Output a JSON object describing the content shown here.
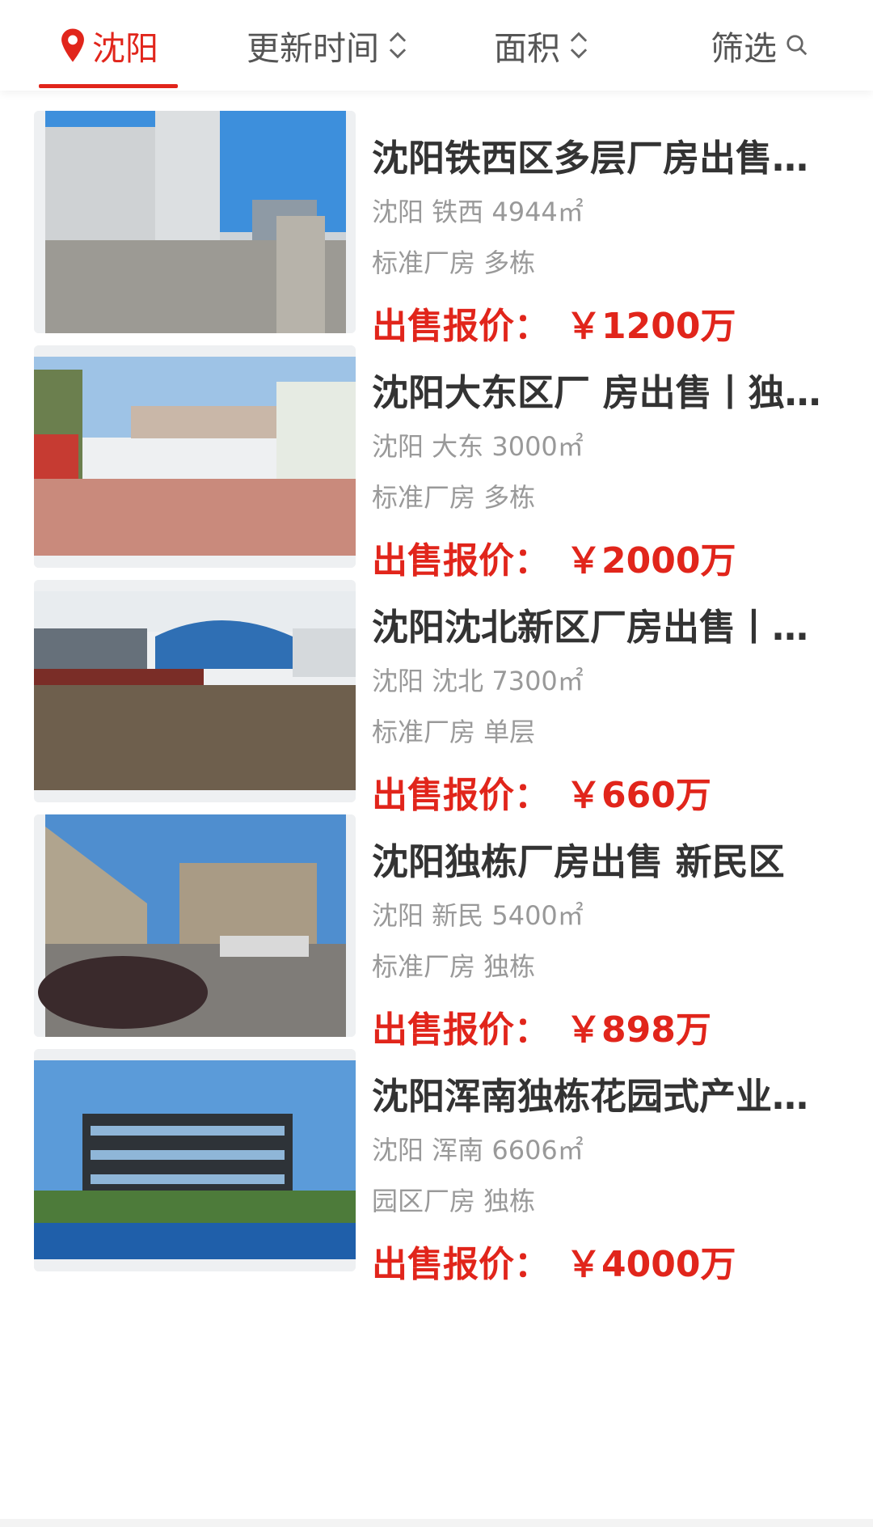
{
  "colors": {
    "accent": "#e1251b",
    "text_main": "#333333",
    "text_muted": "#999999"
  },
  "filter_bar": {
    "city": {
      "label": "沈阳",
      "icon": "location-pin-icon"
    },
    "update_time": {
      "label": "更新时间",
      "icon": "sort-updown-icon"
    },
    "area": {
      "label": "面积",
      "icon": "sort-updown-icon"
    },
    "filter": {
      "label": "筛选",
      "icon": "search-icon"
    }
  },
  "listings": [
    {
      "title": "沈阳铁西区多层厂房出售…",
      "location": "沈阳 铁西 4944㎡",
      "tags": "标准厂房 多栋",
      "price_label": "出售报价：",
      "price": "￥1200万"
    },
    {
      "title": "沈阳大东区厂 房出售丨独…",
      "location": "沈阳 大东 3000㎡",
      "tags": "标准厂房 多栋",
      "price_label": "出售报价：",
      "price": "￥2000万"
    },
    {
      "title": "沈阳沈北新区厂房出售丨…",
      "location": "沈阳 沈北 7300㎡",
      "tags": "标准厂房 单层",
      "price_label": "出售报价：",
      "price": "￥660万"
    },
    {
      "title": "沈阳独栋厂房出售 新民区",
      "location": "沈阳 新民 5400㎡",
      "tags": "标准厂房 独栋",
      "price_label": "出售报价：",
      "price": "￥898万"
    },
    {
      "title": "沈阳浑南独栋花园式产业…",
      "location": "沈阳 浑南 6606㎡",
      "tags": "园区厂房 独栋",
      "price_label": "出售报价：",
      "price": "￥4000万"
    }
  ]
}
